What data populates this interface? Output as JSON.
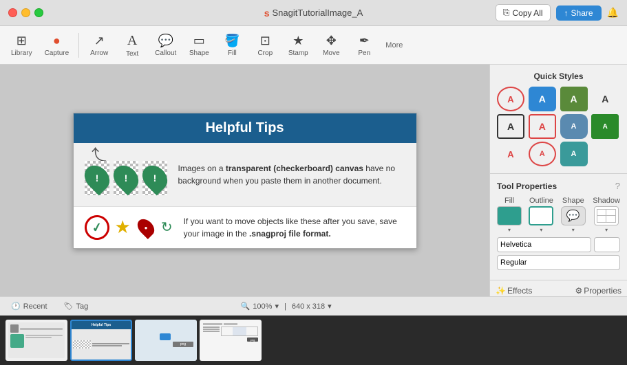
{
  "app": {
    "title": "SnagitTutorialImage_A",
    "title_prefix": "s"
  },
  "titlebar": {
    "copy_all_label": "Copy All",
    "share_label": "Share"
  },
  "toolbar": {
    "tools": [
      {
        "id": "library",
        "label": "Library",
        "icon": "⊞"
      },
      {
        "id": "capture",
        "label": "Capture",
        "icon": "●"
      },
      {
        "id": "arrow",
        "label": "Arrow",
        "icon": "↗"
      },
      {
        "id": "text",
        "label": "Text",
        "icon": "A"
      },
      {
        "id": "callout",
        "label": "Callout",
        "icon": "💬"
      },
      {
        "id": "shape",
        "label": "Shape",
        "icon": "▭"
      },
      {
        "id": "fill",
        "label": "Fill",
        "icon": "🪣"
      },
      {
        "id": "crop",
        "label": "Crop",
        "icon": "⊡"
      },
      {
        "id": "stamp",
        "label": "Stamp",
        "icon": "★"
      },
      {
        "id": "move",
        "label": "Move",
        "icon": "✥"
      },
      {
        "id": "pen",
        "label": "Pen",
        "icon": "✒"
      }
    ],
    "more_label": "More"
  },
  "canvas": {
    "image_title": "Helpful Tips",
    "para1": "Images on a transparent (checkerboard) canvas have no background when you paste them in another document.",
    "para1_bold": "transparent (checkerboard) canvas",
    "para2_pre": "If you want to move objects like these after you save, save your image in the ",
    "para2_bold": ".snagproj file format.",
    "zoom": "100%",
    "dimensions": "640 x 318"
  },
  "right_panel": {
    "quick_styles_title": "Quick Styles",
    "tool_props_title": "Tool Properties",
    "help_icon": "?",
    "prop_labels": [
      "Fill",
      "Outline",
      "Shape",
      "Shadow"
    ],
    "font_name": "Helvetica",
    "font_style": "Regular"
  },
  "status_bar": {
    "recent_label": "Recent",
    "tag_label": "Tag",
    "zoom_label": "100%",
    "dimensions_label": "640 x 318",
    "effects_label": "Effects",
    "properties_label": "Properties"
  },
  "filmstrip": {
    "thumbs": [
      {
        "id": "thumb1",
        "active": false
      },
      {
        "id": "thumb2",
        "active": true
      },
      {
        "id": "thumb3",
        "active": false
      },
      {
        "id": "thumb4",
        "active": false
      }
    ]
  }
}
